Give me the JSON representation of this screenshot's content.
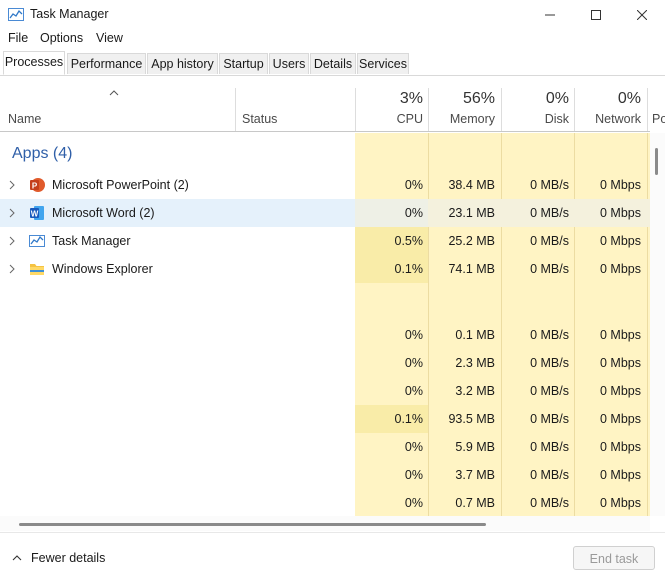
{
  "window": {
    "title": "Task Manager",
    "app_icon": "task-manager-icon"
  },
  "window_controls": {
    "minimize": "minimize-icon",
    "maximize": "maximize-icon",
    "close": "close-icon"
  },
  "menu": [
    "File",
    "Options",
    "View"
  ],
  "tabs": [
    {
      "label": "Processes",
      "active": true
    },
    {
      "label": "Performance"
    },
    {
      "label": "App history"
    },
    {
      "label": "Startup"
    },
    {
      "label": "Users"
    },
    {
      "label": "Details"
    },
    {
      "label": "Services"
    }
  ],
  "columns": {
    "name": "Name",
    "status": "Status",
    "cpu": {
      "label": "CPU",
      "pct": "3%"
    },
    "memory": {
      "label": "Memory",
      "pct": "56%"
    },
    "disk": {
      "label": "Disk",
      "pct": "0%"
    },
    "network": {
      "label": "Network",
      "pct": "0%"
    },
    "power": {
      "label": "Po"
    }
  },
  "group": {
    "title": "Apps (4)"
  },
  "apps": [
    {
      "name": "Microsoft PowerPoint (2)",
      "icon": "powerpoint-icon",
      "cpu": "0%",
      "memory": "38.4 MB",
      "disk": "0 MB/s",
      "network": "0 Mbps"
    },
    {
      "name": "Microsoft Word (2)",
      "icon": "word-icon",
      "cpu": "0%",
      "memory": "23.1 MB",
      "disk": "0 MB/s",
      "network": "0 Mbps",
      "hover": true
    },
    {
      "name": "Task Manager",
      "icon": "task-manager-icon",
      "cpu": "0.5%",
      "memory": "25.2 MB",
      "disk": "0 MB/s",
      "network": "0 Mbps"
    },
    {
      "name": "Windows Explorer",
      "icon": "folder-icon",
      "cpu": "0.1%",
      "memory": "74.1 MB",
      "disk": "0 MB/s",
      "network": "0 Mbps"
    }
  ],
  "background_rows": [
    {
      "cpu": "0%",
      "memory": "0.1 MB",
      "disk": "0 MB/s",
      "network": "0 Mbps"
    },
    {
      "cpu": "0%",
      "memory": "2.3 MB",
      "disk": "0 MB/s",
      "network": "0 Mbps"
    },
    {
      "cpu": "0%",
      "memory": "3.2 MB",
      "disk": "0 MB/s",
      "network": "0 Mbps"
    },
    {
      "cpu": "0.1%",
      "memory": "93.5 MB",
      "disk": "0 MB/s",
      "network": "0 Mbps"
    },
    {
      "cpu": "0%",
      "memory": "5.9 MB",
      "disk": "0 MB/s",
      "network": "0 Mbps"
    },
    {
      "cpu": "0%",
      "memory": "3.7 MB",
      "disk": "0 MB/s",
      "network": "0 Mbps"
    },
    {
      "cpu": "0%",
      "memory": "0.7 MB",
      "disk": "0 MB/s",
      "network": "0 Mbps"
    }
  ],
  "footer": {
    "fewer_details": "Fewer details",
    "end_task": "End task"
  },
  "colors": {
    "heat_light": "#fff4c4",
    "heat_mid": "#f9eca8",
    "hover": "#e5f1fb",
    "group_title": "#2f5fa8"
  }
}
